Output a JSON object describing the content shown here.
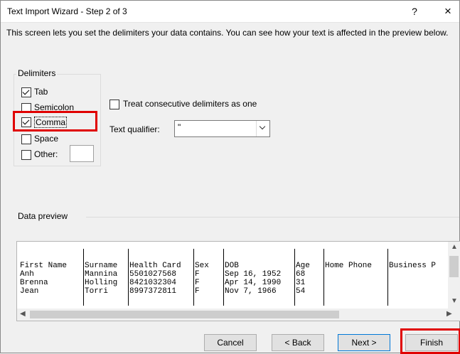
{
  "window": {
    "title": "Text Import Wizard - Step 2 of 3",
    "help_label": "?",
    "close_label": "×"
  },
  "description": "This screen lets you set the delimiters your data contains.  You can see how your text is affected in the preview below.",
  "delimiters": {
    "group_label": "Delimiters",
    "items": [
      {
        "label": "Tab",
        "checked": true
      },
      {
        "label": "Semicolon",
        "checked": false
      },
      {
        "label": "Comma",
        "checked": true,
        "highlighted": true
      },
      {
        "label": "Space",
        "checked": false
      },
      {
        "label": "Other:",
        "checked": false,
        "value": ""
      }
    ]
  },
  "consecutive": {
    "label": "Treat consecutive delimiters as one",
    "checked": false
  },
  "qualifier": {
    "label": "Text qualifier:",
    "value": "\""
  },
  "preview": {
    "label": "Data preview",
    "columns": [
      "First Name",
      "Surname",
      "Health Card",
      "Sex",
      "DOB",
      "Age",
      "Home Phone",
      "Business P"
    ],
    "rows": [
      [
        "Anh",
        "Mannina",
        "5501027568",
        "F",
        "Sep 16, 1952",
        "68",
        "",
        ""
      ],
      [
        "Brenna",
        "Holling",
        "8421032304",
        "F",
        "Apr 14, 1990",
        "31",
        "",
        ""
      ],
      [
        "Jean",
        "Torri",
        "8997372811",
        "F",
        "Nov 7, 1966",
        "54",
        "",
        ""
      ]
    ]
  },
  "buttons": {
    "cancel": "Cancel",
    "back": "< Back",
    "next": "Next >",
    "finish": "Finish"
  },
  "colors": {
    "highlight": "#e00000",
    "accent": "#0078d7"
  }
}
